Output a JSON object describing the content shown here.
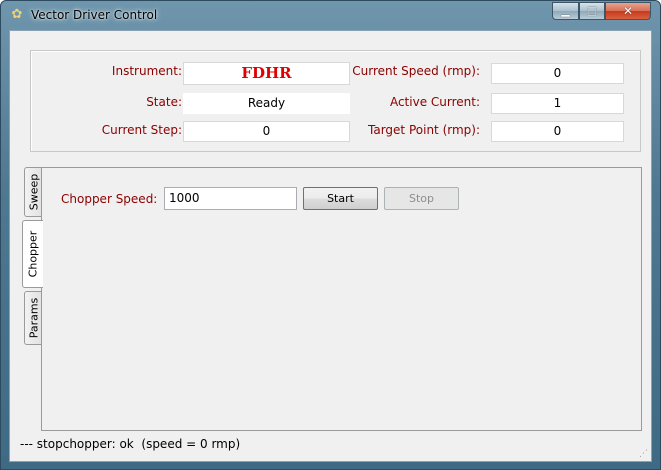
{
  "window": {
    "title": "Vector Driver Control",
    "app_icon": "turtle-icon",
    "controls": {
      "minimize": "minimize-icon",
      "maximize": "maximize-icon",
      "close": "close-icon"
    }
  },
  "info": {
    "instrument_label": "Instrument:",
    "instrument_value": "FDHR",
    "state_label": "State:",
    "state_value": "Ready",
    "current_step_label": "Current Step:",
    "current_step_value": "0",
    "current_speed_label": "Current Speed (rmp):",
    "current_speed_value": "0",
    "active_current_label": "Active Current:",
    "active_current_value": "1",
    "target_point_label": "Target Point (rmp):",
    "target_point_value": "0"
  },
  "tabs": [
    {
      "label": "Sweep",
      "active": false
    },
    {
      "label": "Chopper",
      "active": true
    },
    {
      "label": "Params",
      "active": false
    }
  ],
  "chopper": {
    "speed_label": "Chopper Speed:",
    "speed_value": "1000",
    "start_label": "Start",
    "stop_label": "Stop"
  },
  "status_text": "--- stopchopper: ok  (speed = 0 rmp)",
  "colors": {
    "label": "#8b0000",
    "instrument_value": "#e00000"
  }
}
